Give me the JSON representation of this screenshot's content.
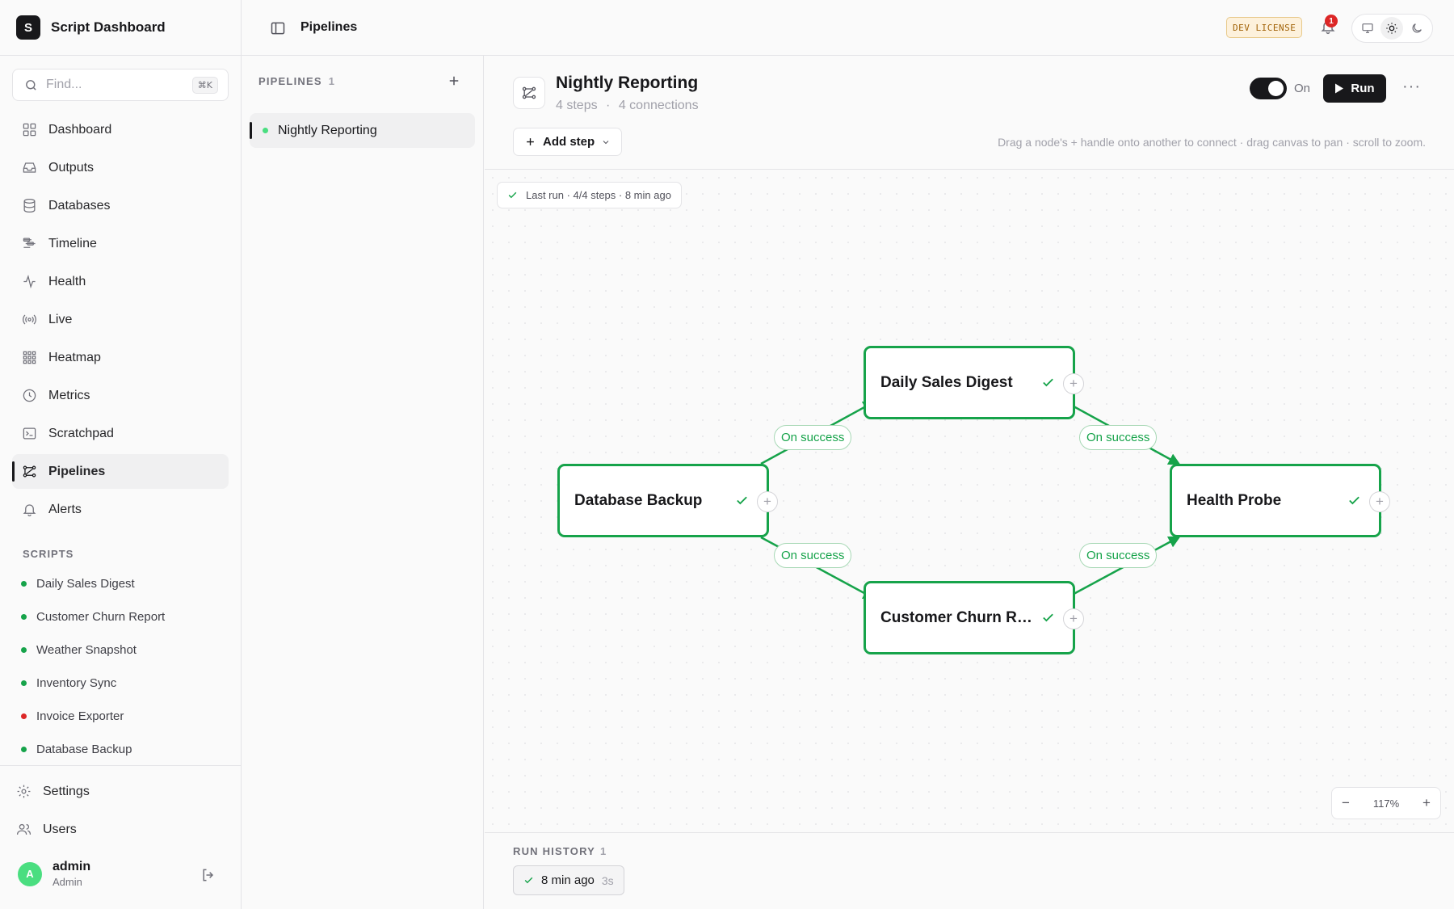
{
  "app": {
    "logo_letter": "S",
    "name": "Script Dashboard"
  },
  "search": {
    "placeholder": "Find...",
    "shortcut": "⌘K"
  },
  "nav": [
    {
      "label": "Dashboard",
      "icon": "grid-icon"
    },
    {
      "label": "Outputs",
      "icon": "inbox-icon"
    },
    {
      "label": "Databases",
      "icon": "database-icon"
    },
    {
      "label": "Timeline",
      "icon": "timeline-icon"
    },
    {
      "label": "Health",
      "icon": "activity-icon"
    },
    {
      "label": "Live",
      "icon": "broadcast-icon"
    },
    {
      "label": "Heatmap",
      "icon": "heatmap-icon"
    },
    {
      "label": "Metrics",
      "icon": "clock-icon"
    },
    {
      "label": "Scratchpad",
      "icon": "terminal-icon"
    },
    {
      "label": "Pipelines",
      "icon": "workflow-icon",
      "active": true
    },
    {
      "label": "Alerts",
      "icon": "bell-icon"
    }
  ],
  "scripts": {
    "heading": "SCRIPTS",
    "items": [
      {
        "label": "Daily Sales Digest",
        "status_color": "#16a34a"
      },
      {
        "label": "Customer Churn Report",
        "status_color": "#16a34a"
      },
      {
        "label": "Weather Snapshot",
        "status_color": "#16a34a"
      },
      {
        "label": "Inventory Sync",
        "status_color": "#16a34a"
      },
      {
        "label": "Invoice Exporter",
        "status_color": "#dc2626"
      },
      {
        "label": "Database Backup",
        "status_color": "#16a34a"
      }
    ]
  },
  "bottom_nav": [
    {
      "label": "Settings",
      "icon": "gear-icon"
    },
    {
      "label": "Users",
      "icon": "users-icon"
    }
  ],
  "user": {
    "initial": "A",
    "name": "admin",
    "role": "Admin"
  },
  "topbar": {
    "breadcrumb": "Pipelines",
    "license": "DEV LICENSE",
    "notification_count": "1"
  },
  "pipelines_panel": {
    "heading": "PIPELINES",
    "count": "1",
    "items": [
      {
        "label": "Nightly Reporting",
        "status_color": "#16a34a"
      }
    ]
  },
  "pipeline": {
    "title": "Nightly Reporting",
    "steps": "4 steps",
    "separator": "·",
    "connections": "4 connections",
    "add_step_label": "Add step",
    "hint": "Drag a node's + handle onto another to connect · drag canvas to pan · scroll to zoom.",
    "enabled_label": "On",
    "run_label": "Run",
    "more_label": "···"
  },
  "canvas": {
    "last_run": "Last run · 4/4 steps · 8 min ago",
    "nodes": [
      {
        "id": "n1",
        "label": "Database Backup",
        "status": "success"
      },
      {
        "id": "n2",
        "label": "Daily Sales Digest",
        "status": "success"
      },
      {
        "id": "n3",
        "label": "Customer Churn Re...",
        "status": "success"
      },
      {
        "id": "n4",
        "label": "Health Probe",
        "status": "success"
      }
    ],
    "edges": [
      {
        "from": "n1",
        "to": "n2",
        "label": "On success"
      },
      {
        "from": "n1",
        "to": "n3",
        "label": "On success"
      },
      {
        "from": "n2",
        "to": "n4",
        "label": "On success"
      },
      {
        "from": "n3",
        "to": "n4",
        "label": "On success"
      }
    ],
    "zoom": {
      "minus": "−",
      "level": "117%",
      "plus": "+"
    }
  },
  "run_history": {
    "heading": "RUN HISTORY",
    "count": "1",
    "items": [
      {
        "time": "8 min ago",
        "duration": "3s",
        "status": "success"
      }
    ]
  },
  "colors": {
    "success": "#16a34a",
    "error": "#dc2626",
    "primary": "#18181b"
  }
}
